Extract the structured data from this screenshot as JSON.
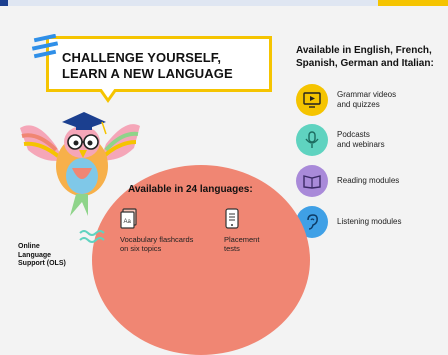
{
  "headline": {
    "line1": "CHALLENGE YOURSELF,",
    "line2": "LEARN A NEW LANGUAGE"
  },
  "available_langs_title": "Available in English, French, Spanish, German and Italian:",
  "features": [
    {
      "label": "Grammar videos\nand quizzes",
      "icon": "video-icon",
      "color": "#f5c400"
    },
    {
      "label": "Podcasts\nand webinars",
      "icon": "microphone-icon",
      "color": "#5fd3c0"
    },
    {
      "label": "Reading modules",
      "icon": "book-icon",
      "color": "#a98ad9"
    },
    {
      "label": "Listening modules",
      "icon": "ear-icon",
      "color": "#3fa0e6"
    }
  ],
  "languages_section": {
    "title": "Available in 24 languages:",
    "items": [
      {
        "label": "Vocabulary flashcards\non six topics",
        "icon": "flashcard-icon"
      },
      {
        "label": "Placement\ntests",
        "icon": "tablet-icon"
      }
    ]
  },
  "ols_label": "Online\nLanguage\nSupport (OLS)",
  "colors": {
    "accent_yellow": "#f5c400",
    "salmon": "#f08673",
    "brand_blue": "#1b3f8f"
  }
}
